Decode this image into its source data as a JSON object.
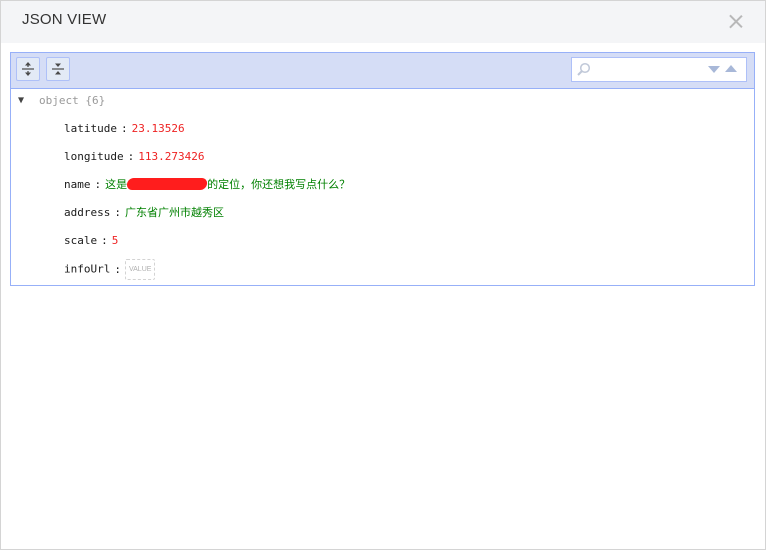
{
  "dialog": {
    "title": "JSON VIEW"
  },
  "search": {
    "placeholder": ""
  },
  "tree": {
    "root_label": "object {6}",
    "fields": {
      "latitude": {
        "key": "latitude",
        "value": "23.13526"
      },
      "longitude": {
        "key": "longitude",
        "value": "113.273426"
      },
      "name": {
        "key": "name",
        "value_prefix": "这是",
        "value_suffix": "的定位，你还想我写点什么？"
      },
      "address": {
        "key": "address",
        "value": "广东省广州市越秀区"
      },
      "scale": {
        "key": "scale",
        "value": "5"
      },
      "infoUrl": {
        "key": "infoUrl",
        "value_placeholder": "VALUE"
      }
    },
    "separator": ":"
  },
  "colors": {
    "number": "#ee2222",
    "string": "#008000",
    "menu_bg": "#d5ddf6",
    "border": "#97b0f8"
  },
  "icons": [
    "collapse-all-icon",
    "expand-all-icon",
    "search-icon",
    "close-icon",
    "search-next-icon",
    "search-previous-icon"
  ]
}
